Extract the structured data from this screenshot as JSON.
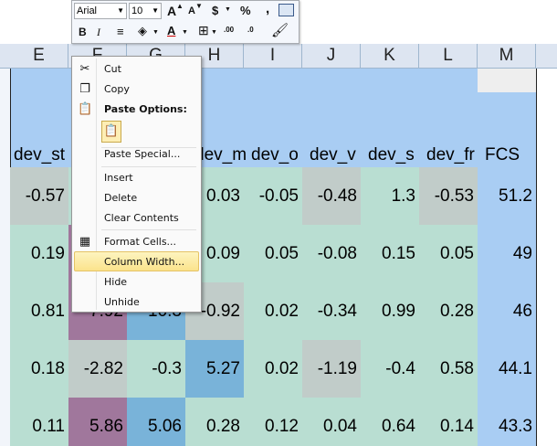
{
  "mini_toolbar": {
    "font_name": "Arial",
    "font_size": "10",
    "grow_font": "A",
    "shrink_font": "A",
    "currency": "$",
    "percent": "%",
    "comma": ",",
    "bold": "B",
    "italic": "I",
    "font_color": "A",
    "decrease_decimal": ".00",
    "increase_decimal": ".0"
  },
  "columns": [
    "E",
    "F",
    "G",
    "H",
    "I",
    "J",
    "K",
    "L",
    "M"
  ],
  "header_row": [
    "dev_st",
    "",
    "",
    "dev_m",
    "dev_o",
    "dev_v",
    "dev_s",
    "dev_fr",
    "FCS"
  ],
  "rows": [
    [
      "-0.57",
      "",
      "",
      "0.03",
      "-0.05",
      "-0.48",
      "1.3",
      "-0.53",
      "51.2"
    ],
    [
      "0.19",
      "",
      "",
      "0.09",
      "0.05",
      "-0.08",
      "0.15",
      "0.05",
      "49"
    ],
    [
      "0.81",
      "-7.92",
      "10.3",
      "-0.92",
      "0.02",
      "-0.34",
      "0.99",
      "0.28",
      "46"
    ],
    [
      "0.18",
      "-2.82",
      "-0.3",
      "5.27",
      "0.02",
      "-1.19",
      "-0.4",
      "0.58",
      "44.1"
    ],
    [
      "0.11",
      "5.86",
      "5.06",
      "0.28",
      "0.12",
      "0.04",
      "0.64",
      "0.14",
      "43.3"
    ]
  ],
  "context_menu": {
    "cut": "Cut",
    "copy": "Copy",
    "paste_options": "Paste Options:",
    "paste_special": "Paste Special...",
    "insert": "Insert",
    "delete": "Delete",
    "clear_contents": "Clear Contents",
    "format_cells": "Format Cells...",
    "column_width": "Column Width...",
    "hide": "Hide",
    "unhide": "Unhide"
  },
  "colors": {
    "column_header_bg": "#dde5f1",
    "selection_blue": "#a9cdf3",
    "teal_cell": "#b9ded2",
    "gray_cell": "#c1ccc9",
    "purple_cell": "#a0779c",
    "blue_cell": "#79b3d9",
    "menu_highlight": "#fbe38c"
  }
}
